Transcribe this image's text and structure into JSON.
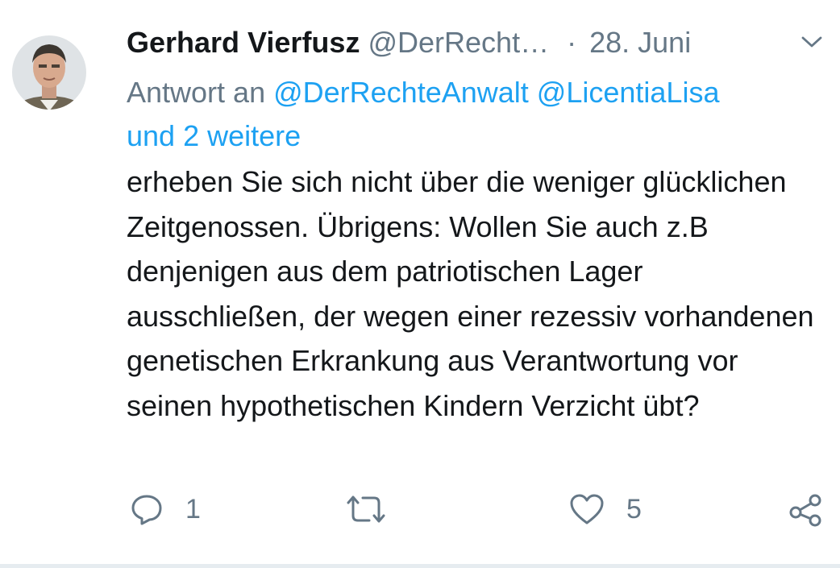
{
  "tweet": {
    "author_name": "Gerhard Vierfusz",
    "author_handle": "@DerRecht…",
    "separator": "·",
    "date": "28. Juni",
    "reply_prefix": "Antwort an",
    "reply_mentions": [
      "@DerRechteAnwalt",
      "@LicentiaLisa"
    ],
    "reply_others": "und 2 weitere",
    "text": "erheben Sie sich nicht über die weniger glücklichen Zeitgenossen. Übrigens: Wollen Sie auch z.B denjenigen aus dem patriotischen Lager ausschließen, der wegen einer rezessiv vorhandenen genetischen Erkrankung aus Verantwortung vor seinen hypothetischen Kindern Verzicht übt?",
    "actions": {
      "reply_count": "1",
      "retweet_count": "",
      "like_count": "5"
    }
  },
  "icons": {
    "avatar": "avatar-photo",
    "menu": "chevron-down-icon",
    "reply": "reply-icon",
    "retweet": "retweet-icon",
    "like": "heart-icon",
    "share": "share-icon"
  },
  "colors": {
    "text": "#14171a",
    "secondary": "#657786",
    "link": "#1da1f2",
    "background": "#ffffff",
    "border": "#e6ecf0"
  }
}
